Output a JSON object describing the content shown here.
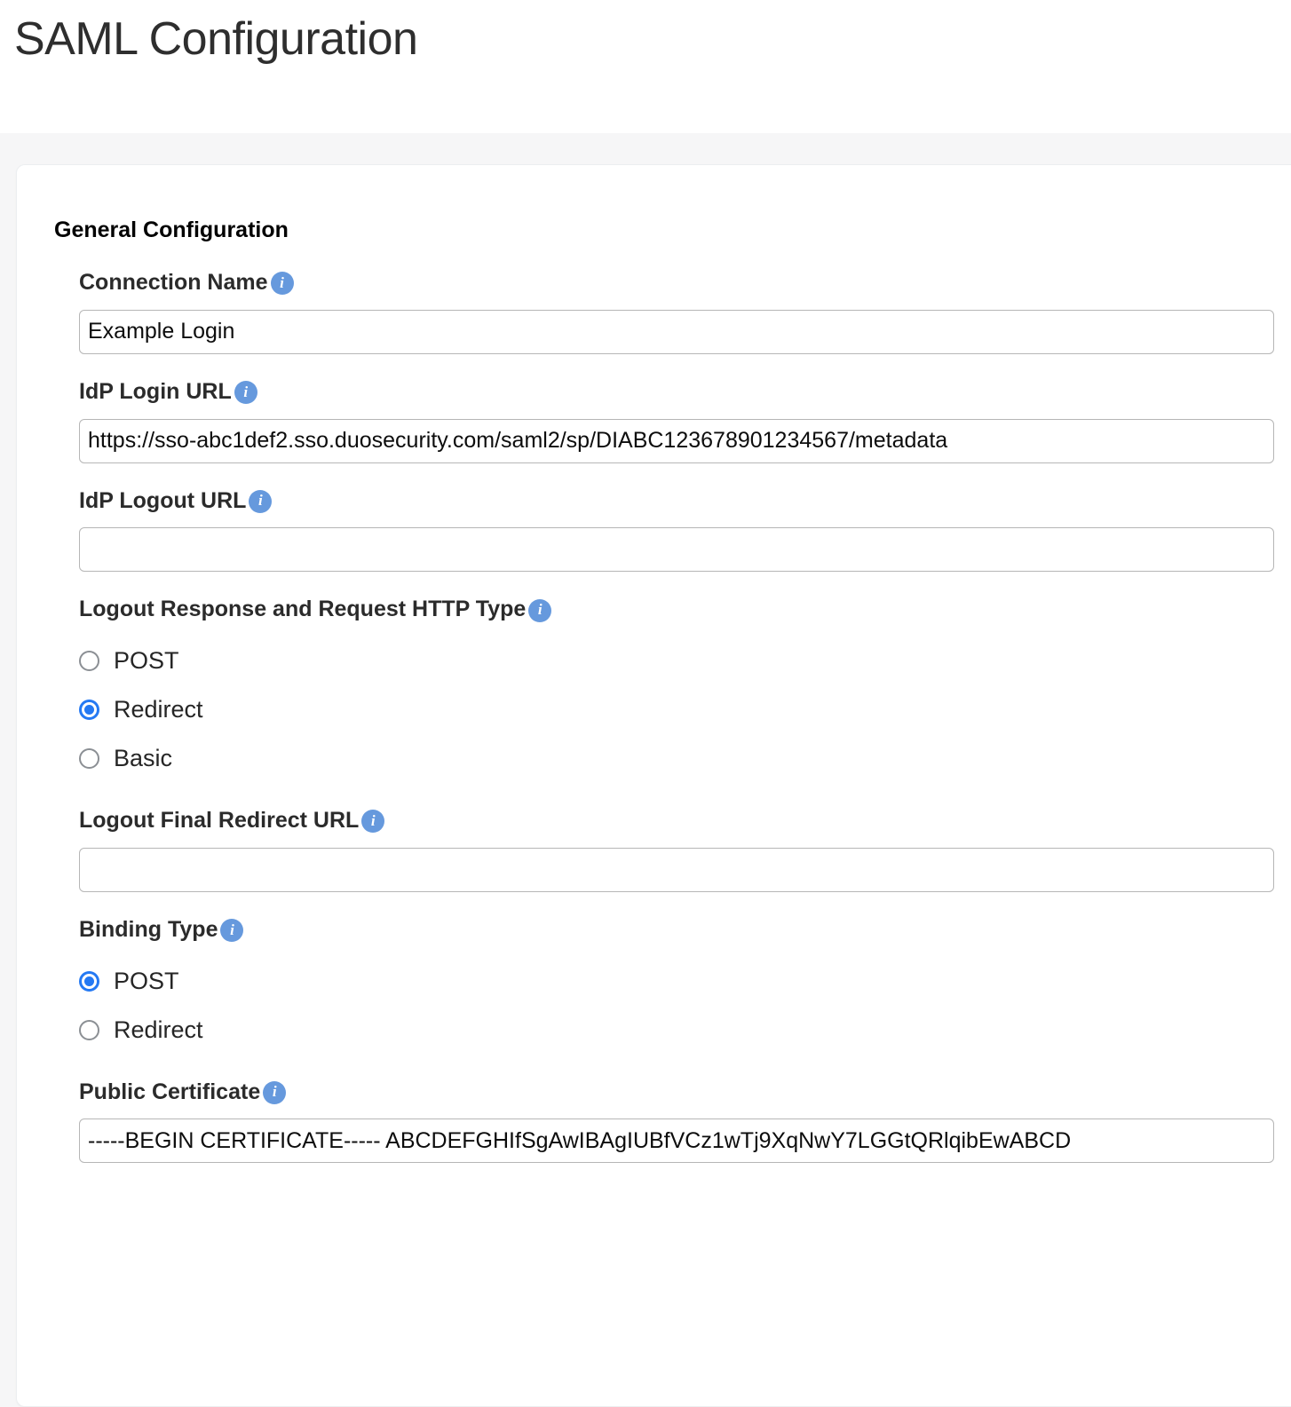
{
  "header": {
    "title": "SAML Configuration"
  },
  "section": {
    "title": "General Configuration"
  },
  "icons": {
    "info": "i",
    "info_name": "info-icon",
    "info_color": "#6699dd"
  },
  "colors": {
    "accent_radio": "#2479f3",
    "info_badge": "#6699dd",
    "page_background": "#f6f6f7",
    "card_background": "#ffffff",
    "label_text": "#2b2b2b",
    "input_border": "#b6b6b6"
  },
  "fields": {
    "connection_name": {
      "label": "Connection Name",
      "value": "Example Login",
      "placeholder": ""
    },
    "idp_login_url": {
      "label": "IdP Login URL",
      "value": "https://sso-abc1def2.sso.duosecurity.com/saml2/sp/DIABC123678901234567/metadata",
      "placeholder": ""
    },
    "idp_logout_url": {
      "label": "IdP Logout URL",
      "value": "",
      "placeholder": ""
    },
    "logout_http_type": {
      "label": "Logout Response and Request HTTP Type",
      "selected": "Redirect",
      "options": [
        {
          "label": "POST",
          "checked": false
        },
        {
          "label": "Redirect",
          "checked": true
        },
        {
          "label": "Basic",
          "checked": false
        }
      ]
    },
    "logout_final_redirect_url": {
      "label": "Logout Final Redirect URL",
      "value": "",
      "placeholder": ""
    },
    "binding_type": {
      "label": "Binding Type",
      "selected": "POST",
      "options": [
        {
          "label": "POST",
          "checked": true
        },
        {
          "label": "Redirect",
          "checked": false
        }
      ]
    },
    "public_certificate": {
      "label": "Public Certificate",
      "value": "-----BEGIN CERTIFICATE----- ABCDEFGHIfSgAwIBAgIUBfVCz1wTj9XqNwY7LGGtQRlqibEwABCD",
      "placeholder": ""
    }
  }
}
